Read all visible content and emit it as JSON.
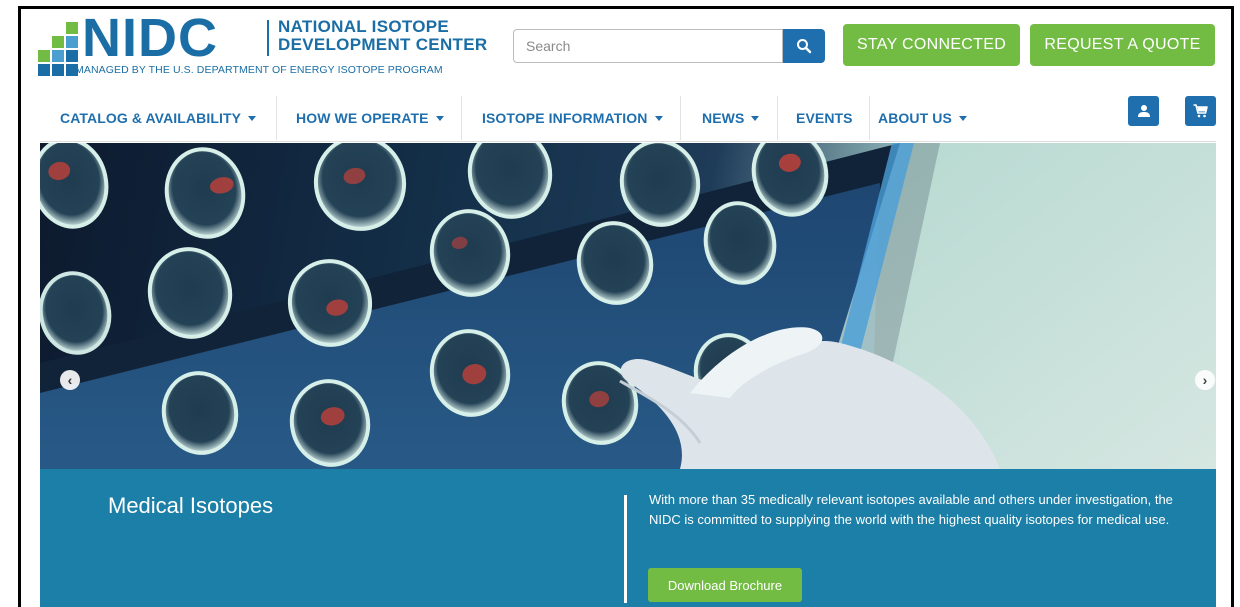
{
  "header": {
    "logo_word": "NIDC",
    "logo_title_line1": "NATIONAL ISOTOPE",
    "logo_title_line2": "DEVELOPMENT CENTER",
    "logo_subtitle": "MANAGED BY THE U.S. DEPARTMENT OF ENERGY ISOTOPE PROGRAM",
    "search": {
      "placeholder": "Search"
    },
    "stay_connected_label": "STAY CONNECTED",
    "request_quote_label": "REQUEST A QUOTE"
  },
  "nav": {
    "items": [
      {
        "label": "CATALOG & AVAILABILITY",
        "dropdown": true
      },
      {
        "label": "HOW WE OPERATE",
        "dropdown": true
      },
      {
        "label": "ISOTOPE INFORMATION",
        "dropdown": true
      },
      {
        "label": "NEWS",
        "dropdown": true
      },
      {
        "label": "EVENTS",
        "dropdown": false
      },
      {
        "label": "ABOUT US",
        "dropdown": true
      }
    ],
    "icons": [
      "user-icon",
      "cart-icon"
    ]
  },
  "hero": {
    "caption_title": "Medical Isotopes",
    "caption_text": "With more than 35 medically relevant isotopes available and others under investigation, the NIDC is committed to supplying the world with the highest quality isotopes for medical use.",
    "button_label": "Download Brochure"
  },
  "colors": {
    "brand_blue": "#1a6ea5",
    "nav_blue": "#1f6fae",
    "green": "#72bc44",
    "caption_blue": "#1b7fa7"
  }
}
